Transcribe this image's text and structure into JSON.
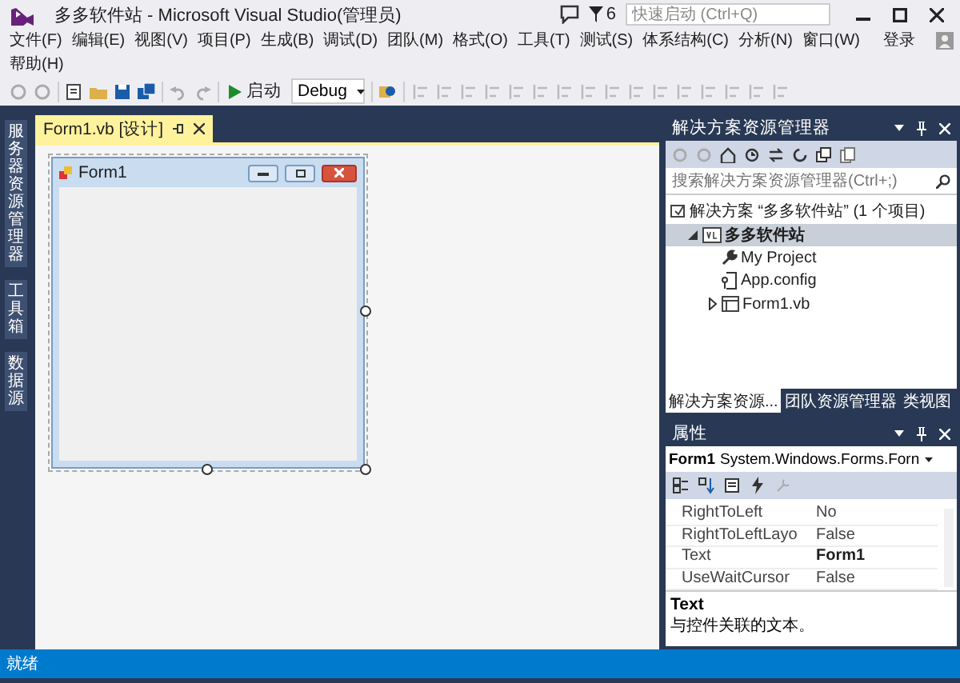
{
  "window": {
    "title": "多多软件站 - Microsoft Visual Studio(管理员)",
    "notification_count": "6",
    "quick_launch": {
      "placeholder": "快速启动 (Ctrl+Q)"
    }
  },
  "menu": {
    "items": [
      "文件(F)",
      "编辑(E)",
      "视图(V)",
      "项目(P)",
      "生成(B)",
      "调试(D)",
      "团队(M)",
      "格式(O)",
      "工具(T)",
      "测试(S)",
      "体系结构(C)",
      "分析(N)",
      "窗口(W)",
      "帮助(H)"
    ],
    "sign_in": "登录"
  },
  "toolbar": {
    "start_button": "启动",
    "configuration": "Debug"
  },
  "side_tabs": [
    "服务器资源管理器",
    "工具箱",
    "数据源"
  ],
  "document_tabs": [
    {
      "label": "Form1.vb [设计]",
      "selected": true
    }
  ],
  "designer": {
    "form_title": "Form1"
  },
  "solution_explorer": {
    "title": "解决方案资源管理器",
    "search": {
      "placeholder": "搜索解决方案资源管理器(Ctrl+;)"
    },
    "tree": [
      {
        "label": "解决方案 “多多软件站” (1 个项目)",
        "kind": "solution",
        "selected": false,
        "children": [
          {
            "label": "多多软件站",
            "kind": "project",
            "expanded": true,
            "selected": true,
            "children": [
              {
                "label": "My Project",
                "kind": "settings",
                "selected": false
              },
              {
                "label": "App.config",
                "kind": "config",
                "selected": false
              },
              {
                "label": "Form1.vb",
                "kind": "form",
                "expanded": false,
                "selected": false
              }
            ]
          }
        ]
      }
    ],
    "tabs": [
      {
        "label": "解决方案资源...",
        "selected": true
      },
      {
        "label": "团队资源管理器",
        "selected": false
      },
      {
        "label": "类视图",
        "selected": false
      }
    ]
  },
  "properties": {
    "title": "属性",
    "object_name": "Form1",
    "object_type": "System.Windows.Forms.Forn",
    "rows": [
      {
        "name": "RightToLeft",
        "value": "No",
        "modified": false
      },
      {
        "name": "RightToLeftLayo",
        "value": "False",
        "modified": false
      },
      {
        "name": "Text",
        "value": "Form1",
        "modified": true
      },
      {
        "name": "UseWaitCursor",
        "value": "False",
        "modified": false
      }
    ],
    "description": {
      "name": "Text",
      "text": "与控件关联的文本。"
    }
  },
  "status_bar": {
    "text": "就绪"
  }
}
